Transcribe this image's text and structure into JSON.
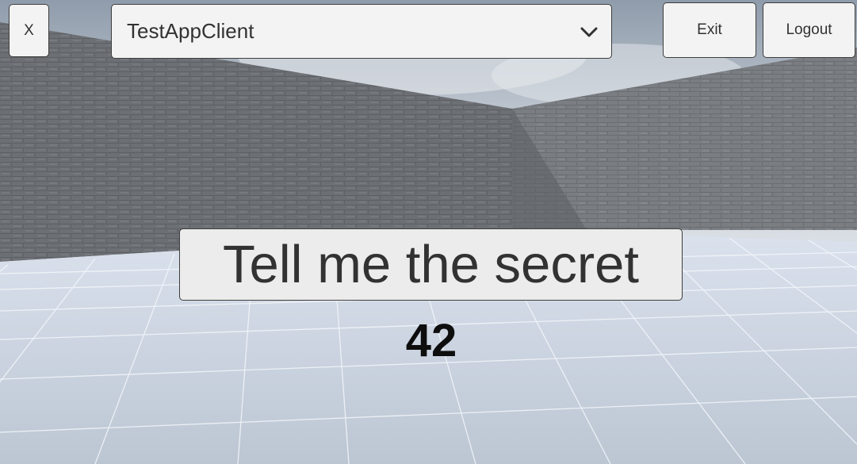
{
  "toolbar": {
    "close_label": "X",
    "exit_label": "Exit",
    "logout_label": "Logout"
  },
  "client_select": {
    "selected": "TestAppClient",
    "icon": "chevron-down-icon"
  },
  "main": {
    "secret_button_label": "Tell me the secret",
    "secret_value": "42"
  },
  "colors": {
    "button_bg": "#f3f3f3",
    "button_border": "#3e3e3e",
    "wall": "#6e7175",
    "floor": "#c9d1dd",
    "sky": "#c0c8d2"
  }
}
